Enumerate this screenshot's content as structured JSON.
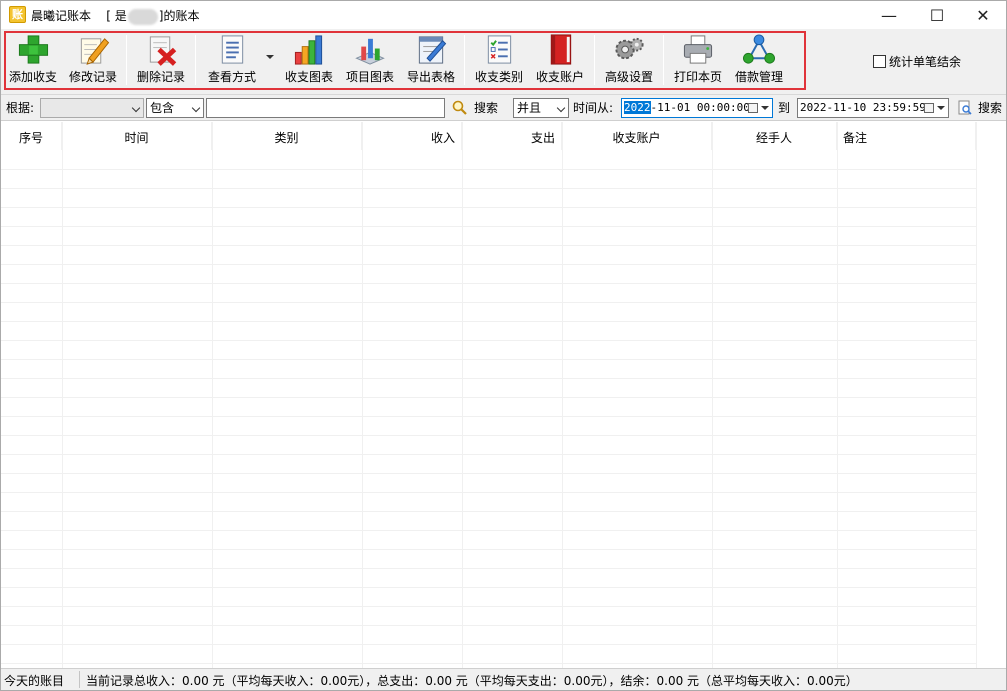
{
  "window": {
    "app_name": "晨曦记账本",
    "title_prefix": "[ 是",
    "title_suffix": "]的账本",
    "minimize": "—",
    "maximize": "☐",
    "close": "✕"
  },
  "app_icon_char": "账",
  "toolbar": {
    "add_income_expense": "添加收支",
    "edit_record": "修改记录",
    "delete_record": "删除记录",
    "view_mode": "查看方式",
    "income_expense_chart": "收支图表",
    "item_chart": "项目图表",
    "export_table": "导出表格",
    "categories": "收支类别",
    "accounts": "收支账户",
    "advanced_settings": "高级设置",
    "print_page": "打印本页",
    "loan_management": "借款管理",
    "stat_single_settlement": "统计单笔结余"
  },
  "filter": {
    "by_label": "根据:",
    "field_value": "",
    "match_value": "包含",
    "keyword_value": "",
    "search_label": "搜索",
    "logic_value": "并且",
    "time_from_label": "时间从:",
    "date_from_selected": "2022",
    "date_from_rest": "-11-01 00:00:00",
    "to_label": "到",
    "date_to": "2022-11-10 23:59:59",
    "search2_label": "搜索"
  },
  "table": {
    "columns": [
      "序号",
      "时间",
      "类别",
      "收入",
      "支出",
      "收支账户",
      "经手人",
      "备注"
    ],
    "rows": []
  },
  "status": {
    "today": "今天的账目",
    "summary": "当前记录总收入：0.00 元（平均每天收入：0.00元），总支出：0.00 元（平均每天支出：0.00元），结余：0.00 元（总平均每天收入：0.00元）"
  },
  "colors": {
    "toolbar_highlight": "#e0333a",
    "selection": "#0078d7"
  }
}
